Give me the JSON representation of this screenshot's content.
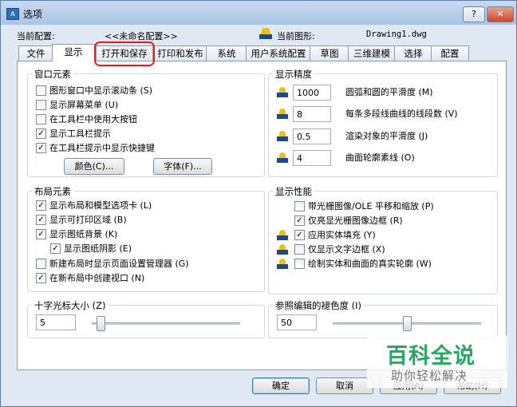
{
  "window": {
    "title": "选项",
    "app_icon": "autocad-app-icon",
    "help_label": "?",
    "close_label": "✕"
  },
  "header": {
    "current_profile_label": "当前配置:",
    "current_profile_value": "<<未命名配置>>",
    "current_drawing_label": "当前图形:",
    "current_drawing_value": "Drawing1.dwg"
  },
  "tabs": [
    {
      "label": "文件",
      "active": false
    },
    {
      "label": "显示",
      "active": true
    },
    {
      "label": "打开和保存",
      "active": false,
      "highlighted": true
    },
    {
      "label": "打印和发布",
      "active": false
    },
    {
      "label": "系统",
      "active": false
    },
    {
      "label": "用户系统配置",
      "active": false
    },
    {
      "label": "草图",
      "active": false
    },
    {
      "label": "三维建模",
      "active": false
    },
    {
      "label": "选择",
      "active": false
    },
    {
      "label": "配置",
      "active": false
    }
  ],
  "window_elements": {
    "title": "窗口元素",
    "options": [
      {
        "label": "图形窗口中显示滚动条 (S)",
        "checked": false
      },
      {
        "label": "显示屏幕菜单 (U)",
        "checked": false
      },
      {
        "label": "在工具栏中使用大按钮",
        "checked": false
      },
      {
        "label": "显示工具栏提示",
        "checked": true
      },
      {
        "label": "在工具栏提示中显示快捷键",
        "checked": true
      }
    ],
    "colors_button": "颜色(C)...",
    "fonts_button": "字体(F)..."
  },
  "layout_elements": {
    "title": "布局元素",
    "options": [
      {
        "label": "显示布局和模型选项卡 (L)",
        "checked": true
      },
      {
        "label": "显示可打印区域 (B)",
        "checked": true
      },
      {
        "label": "显示图纸背景 (K)",
        "checked": true
      },
      {
        "label": "显示图纸阴影 (E)",
        "checked": true
      },
      {
        "label": "新建布局时显示页面设置管理器 (G)",
        "checked": false
      },
      {
        "label": "在新布局中创建视口 (N)",
        "checked": true
      }
    ]
  },
  "crosshair": {
    "title": "十字光标大小 (Z)",
    "value": "5",
    "level_percent": 6
  },
  "display_resolution": {
    "title": "显示精度",
    "items": [
      {
        "value": "1000",
        "label": "圆弧和圆的平滑度 (M)"
      },
      {
        "value": "8",
        "label": "每条多段线曲线的线段数 (V)"
      },
      {
        "value": "0.5",
        "label": "渲染对象的平滑度 (J)"
      },
      {
        "value": "4",
        "label": "曲面轮廓素线 (O)"
      }
    ]
  },
  "display_performance": {
    "title": "显示性能",
    "options": [
      {
        "label": "带光栅图像/OLE 平移和缩放 (P)",
        "checked": false,
        "icon": false
      },
      {
        "label": "仅亮显光栅图像边框 (R)",
        "checked": true,
        "icon": false
      },
      {
        "label": "应用实体填充 (Y)",
        "checked": true,
        "icon": true
      },
      {
        "label": "仅显示文字边框 (X)",
        "checked": false,
        "icon": true
      },
      {
        "label": "绘制实体和曲面的真实轮廓 (W)",
        "checked": false,
        "icon": true
      }
    ]
  },
  "xref_fade": {
    "title": "参照编辑的褪色度 (I)",
    "value": "50",
    "level_percent": 50
  },
  "buttons": {
    "ok": "确定",
    "cancel": "取消",
    "apply": "应用(A)",
    "help": "帮助(H)"
  },
  "watermark": {
    "main": "百科全说",
    "sub": "助你轻松解决"
  },
  "colors": {
    "accent": "#3c7fb1",
    "highlight_circle": "#e02020",
    "watermark_green": "#27a862"
  }
}
